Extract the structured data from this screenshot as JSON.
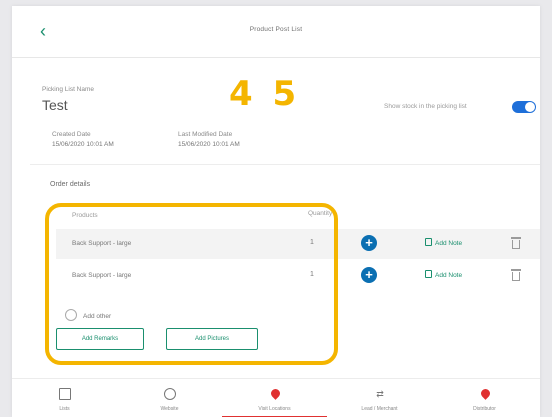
{
  "header": {
    "back_icon": "chevron-left-icon",
    "title": "Product Post List"
  },
  "step_marker": "4 5",
  "picklist": {
    "name_label": "Picking List Name",
    "name_value": "Test",
    "toggle_label": "Show stock in the picking list",
    "toggle_on": true,
    "created_label": "Created Date",
    "created_value": "15/06/2020 10:01 AM",
    "modified_label": "Last Modified Date",
    "modified_value": "15/06/2020 10:01 AM"
  },
  "order": {
    "title": "Order details",
    "col_products": "Products",
    "col_quantity": "Quantity",
    "rows": [
      {
        "product": "Back Support - large",
        "quantity": "1",
        "add_note_label": "Add Note"
      },
      {
        "product": "Back Support - large",
        "quantity": "1",
        "add_note_label": "Add Note"
      }
    ],
    "add_other_label": "Add other",
    "add_remarks_label": "Add Remarks",
    "add_pictures_label": "Add Pictures"
  },
  "colors": {
    "accent": "#1a8f6e",
    "toggle": "#1e6fd9",
    "plus_button": "#0b6fb2",
    "highlight": "#f4b500",
    "nav_active": "#e03131"
  },
  "bottom_nav": {
    "items": [
      {
        "label": "Lists",
        "icon": "home-icon"
      },
      {
        "label": "Website",
        "icon": "globe-icon"
      },
      {
        "label": "Visit Locations",
        "icon": "location-pin-icon"
      },
      {
        "label": "Lead / Merchant",
        "icon": "swap-icon"
      },
      {
        "label": "Distributor",
        "icon": "location-pin-icon"
      }
    ]
  }
}
